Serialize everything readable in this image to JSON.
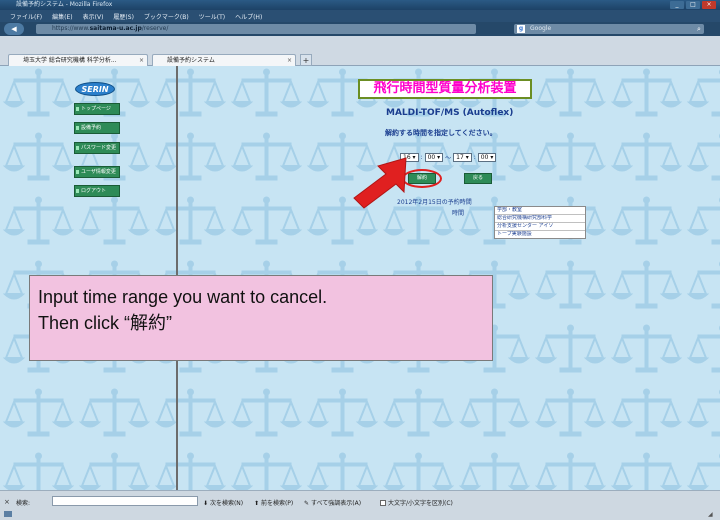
{
  "browser": {
    "window_title": "設備予約システム - Mozilla Firefox",
    "menu": [
      "ファイル(F)",
      "編集(E)",
      "表示(V)",
      "履歴(S)",
      "ブックマーク(B)",
      "ツール(T)",
      "ヘルプ(H)"
    ],
    "url_prefix": "https://www.",
    "url_domain": "saitama-u.ac.jp",
    "url_suffix": "/reserve/",
    "search_placeholder": "Google",
    "tabs": [
      {
        "label": "埼玉大学 総合研究機構 科学分析..."
      },
      {
        "label": "設備予約システム"
      }
    ],
    "new_tab": "+"
  },
  "sidebar": {
    "logo": "SERIN",
    "buttons": [
      {
        "label": "トップページ"
      },
      {
        "label": "設備予約"
      },
      {
        "label": "パスワード変更"
      },
      {
        "label": "ユーザ情報変更"
      },
      {
        "label": "ログアウト"
      }
    ]
  },
  "main": {
    "title": "飛行時間型質量分析装置",
    "subtitle": "MALDI-TOF/MS (Autoflex)",
    "instruction": "解約する時間を指定してください。",
    "time": {
      "start_hour": "16",
      "start_min": "00",
      "end_hour": "17",
      "end_min": "00",
      "separator": ":",
      "range_sep": "〜"
    },
    "cancel_button": "解約",
    "return_button": "戻る",
    "reservation_date": "2012年2月15日の予約時間",
    "reservation_head": "時間",
    "reservation_cells": [
      "学部・教室",
      "総合研究機構研究部科学",
      "分析支援センター アイソ",
      "トープ実験施設"
    ]
  },
  "callout": {
    "line1": "Input time range you want to cancel.",
    "line2": "Then click “解約”"
  },
  "findbar": {
    "close": "×",
    "label": "検索:",
    "next": "次を検索(N)",
    "prev": "前を検索(P)",
    "highlight_all": "すべて強調表示(A)",
    "match_case": "大文字/小文字を区別(C)"
  },
  "colors": {
    "page_bg": "#c7e4f3",
    "pattern": "#9fcbe4",
    "title_text": "#ff00cc",
    "green_button": "#2e8b57",
    "arrow": "#e02020",
    "callout_bg": "#f2c2e0"
  }
}
